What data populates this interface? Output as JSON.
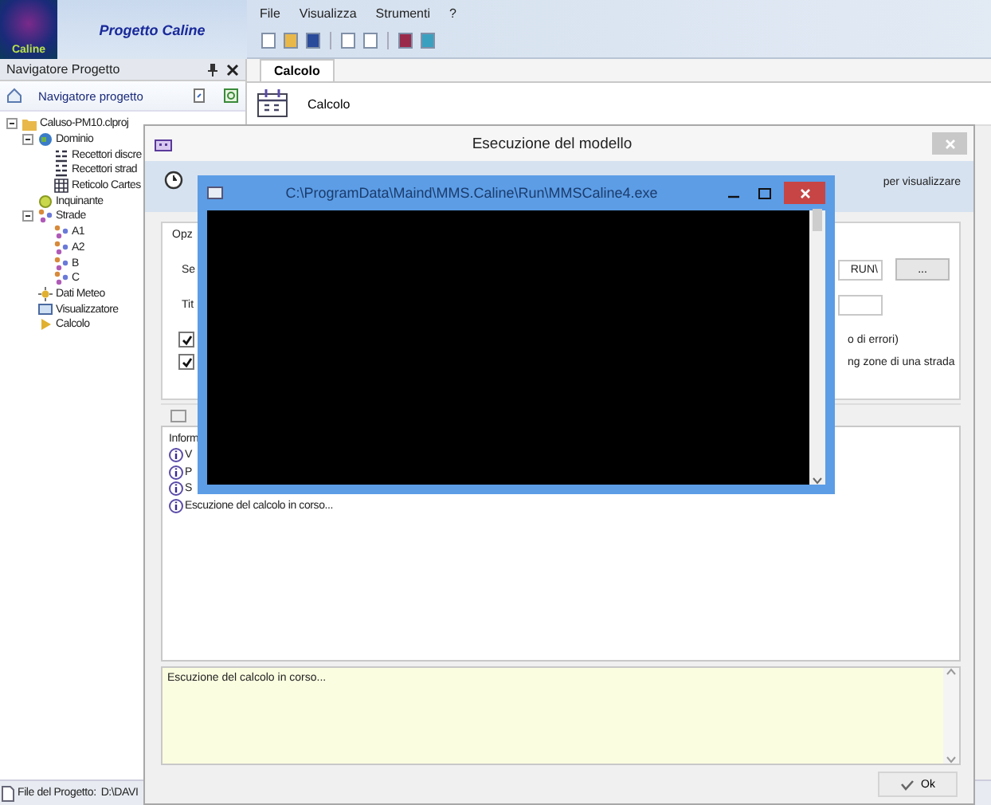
{
  "app": {
    "logo_text": "Caline",
    "title": "Progetto Caline"
  },
  "menu": [
    "File",
    "Visualizza",
    "Strumenti",
    "?"
  ],
  "navigator": {
    "title": "Navigatore Progetto",
    "toolbar_label": "Navigatore progetto",
    "tree": [
      {
        "label": "Caluso-PM10.clproj",
        "kind": "project",
        "expanded": true,
        "children": [
          {
            "label": "Dominio",
            "kind": "domain",
            "expanded": true,
            "children": [
              {
                "label": "Recettori discre",
                "kind": "receptors"
              },
              {
                "label": "Recettori strad",
                "kind": "receptors"
              },
              {
                "label": "Reticolo Cartes",
                "kind": "grid"
              }
            ]
          },
          {
            "label": "Inquinante",
            "kind": "pollutant"
          },
          {
            "label": "Strade",
            "kind": "roads",
            "expanded": true,
            "children": [
              {
                "label": "A1",
                "kind": "road"
              },
              {
                "label": "A2",
                "kind": "road"
              },
              {
                "label": "B",
                "kind": "road"
              },
              {
                "label": "C",
                "kind": "road"
              }
            ]
          },
          {
            "label": "Dati Meteo",
            "kind": "meteo"
          },
          {
            "label": "Visualizzatore",
            "kind": "viewer"
          },
          {
            "label": "Calcolo",
            "kind": "calc"
          }
        ]
      }
    ]
  },
  "tabs": [
    {
      "label": "Calcolo",
      "selected": true
    }
  ],
  "ribbon": {
    "button": "Calcolo"
  },
  "status_bar": {
    "label": "File del Progetto:",
    "value": "D:\\DAVI"
  },
  "dialog": {
    "title": "Esecuzione del modello",
    "info_text": "per visualizzare",
    "group_label": "Opz",
    "folder_label": "Se",
    "folder_value": "RUN\\",
    "browse_button": "...",
    "title_label": "Tit",
    "options": [
      {
        "text": "o di errori)",
        "checked": true
      },
      {
        "text": "ng zone di una strada",
        "checked": true
      }
    ],
    "log_heading": "Inform",
    "log": [
      "V",
      "P",
      "S",
      "Escuzione del calcolo in corso..."
    ],
    "message": "Escuzione del calcolo in corso...",
    "ok_button": "Ok"
  },
  "console": {
    "title": "C:\\ProgramData\\Maind\\MMS.Caline\\Run\\MMSCaline4.exe"
  }
}
